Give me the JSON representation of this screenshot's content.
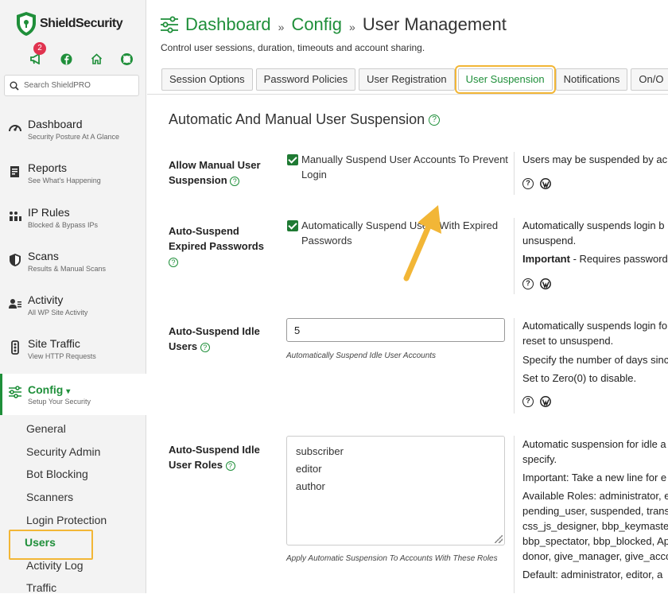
{
  "sidebar": {
    "logo_text": "ShieldSecurity",
    "notification_count": "2",
    "search_placeholder": "Search ShieldPRO",
    "items": [
      {
        "title": "Dashboard",
        "sub": "Security Posture At A Glance",
        "icon": "dashboard-gauge-icon"
      },
      {
        "title": "Reports",
        "sub": "See What's Happening",
        "icon": "reports-icon"
      },
      {
        "title": "IP Rules",
        "sub": "Blocked & Bypass IPs",
        "icon": "ip-rules-icon"
      },
      {
        "title": "Scans",
        "sub": "Results & Manual Scans",
        "icon": "shield-icon"
      },
      {
        "title": "Activity",
        "sub": "All WP Site Activity",
        "icon": "activity-icon"
      },
      {
        "title": "Site Traffic",
        "sub": "View HTTP Requests",
        "icon": "traffic-icon"
      },
      {
        "title": "Config",
        "sub": "Setup Your Security",
        "icon": "config-sliders-icon"
      }
    ],
    "config_caret": "▾",
    "sub_items": [
      "General",
      "Security Admin",
      "Bot Blocking",
      "Scanners",
      "Login Protection",
      "Users",
      "Activity Log",
      "Traffic"
    ]
  },
  "header": {
    "crumb1": "Dashboard",
    "crumb2": "Config",
    "current": "User Management",
    "sep": "»",
    "subtitle": "Control user sessions, duration, timeouts and account sharing."
  },
  "tabs": [
    "Session Options",
    "Password Policies",
    "User Registration",
    "User Suspension",
    "Notifications",
    "On/O"
  ],
  "section_title": "Automatic And Manual User Suspension",
  "options": {
    "manual": {
      "label": "Allow Manual User Suspension",
      "checkbox_label": "Manually Suspend User Accounts To Prevent Login",
      "desc1": "Users may be suspended by ac"
    },
    "expired": {
      "label": "Auto-Suspend Expired Passwords",
      "checkbox_label": "Automatically Suspend Users With Expired Passwords",
      "desc1": "Automatically suspends login b",
      "desc2": "unsuspend.",
      "desc3_bold": "Important",
      "desc3": " - Requires password"
    },
    "idle": {
      "label": "Auto-Suspend Idle Users",
      "value": "5",
      "hint": "Automatically Suspend Idle User Accounts",
      "desc1": "Automatically suspends login fo",
      "desc2": "reset to unsuspend.",
      "desc3": "Specify the number of days sinc",
      "desc4": "Set to Zero(0) to disable."
    },
    "roles": {
      "label": "Auto-Suspend Idle User Roles",
      "roles": [
        "subscriber",
        "editor",
        "author"
      ],
      "hint": "Apply Automatic Suspension To Accounts With These Roles",
      "desc1": "Automatic suspension for idle a",
      "desc2": "specify.",
      "desc3": "Important: Take a new line for e",
      "desc4": "Available Roles: administrator, e",
      "desc5": "pending_user, suspended, trans",
      "desc6": "css_js_designer, bbp_keymaster",
      "desc7": "bbp_spectator, bbp_blocked, Ap",
      "desc8": "donor, give_manager, give_acco",
      "desc9": "Default: administrator, editor, a"
    }
  },
  "help_glyph": "?",
  "colors": {
    "brand_green": "#1f8f3a",
    "highlight": "#f2b636",
    "badge": "#e0334f"
  }
}
